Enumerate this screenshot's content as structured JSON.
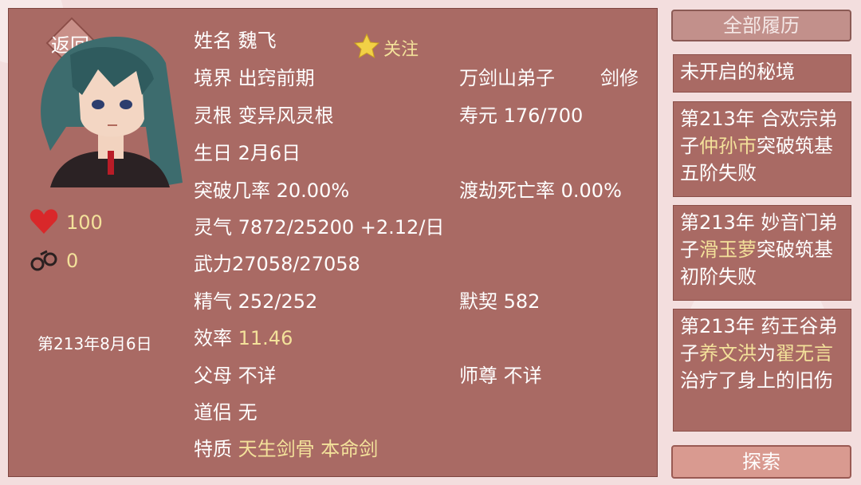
{
  "header": {
    "back_label": "返回",
    "follow_label": "关注"
  },
  "character": {
    "name": "姓名 魏飞",
    "realm": "境界 出窍前期",
    "sect": "万剑山弟子",
    "role": "剑修",
    "root": "灵根 变异风灵根",
    "lifespan": "寿元 176/700",
    "birthday": "生日 2月6日",
    "breakthrough_label": "突破几率 20.00%",
    "tribulation_label": "渡劫死亡率 0.00%",
    "spirit": "灵气 7872/25200 +2.12/日",
    "force": "武力27058/27058",
    "essence": "精气 252/252",
    "tacit": "默契 582",
    "efficiency_label": "效率",
    "efficiency_value": "11.46",
    "parents": "父母 不详",
    "master": "师尊 不详",
    "partner": "道侣 无",
    "traits_label": "特质",
    "trait_1": "天生剑骨",
    "trait_2": "本命剑"
  },
  "stats": {
    "hearts": "100",
    "shackles": "0"
  },
  "date": "第213年8月6日",
  "history": {
    "button_label": "全部履历",
    "explore_label": "探索",
    "card0": "未开启的秘境",
    "card1": {
      "pre": "第213年 合欢宗弟子",
      "name": "仲孙市",
      "post": "突破筑基五阶失败"
    },
    "card2": {
      "pre": "第213年 妙音门弟子",
      "name": "滑玉萝",
      "post": "突破筑基初阶失败"
    },
    "card3": {
      "pre": "第213年 药王谷弟子",
      "name1": "养文洪",
      "mid": "为",
      "name2": "翟无言",
      "post": "治疗了身上的旧伤"
    }
  },
  "colors": {
    "panel": "#a96a64",
    "highlight": "#f3e19a",
    "heart": "#d9282a"
  }
}
